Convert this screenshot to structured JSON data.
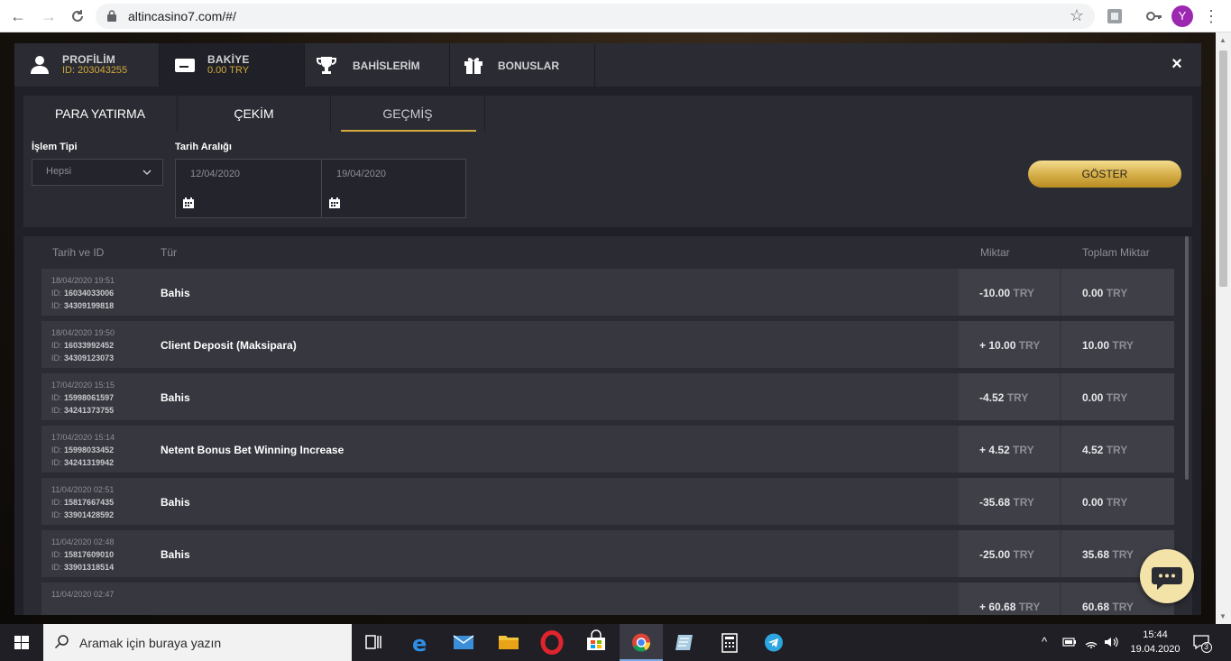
{
  "browser": {
    "url": "altincasino7.com/#/",
    "avatar_letter": "Y"
  },
  "topnav": {
    "profile": {
      "label": "PROFİLİM",
      "id_text": "ID: 203043255"
    },
    "balance": {
      "label": "BAKİYE",
      "amount": "0.00 TRY"
    },
    "bets": {
      "label": "BAHİSLERİM"
    },
    "bonuses": {
      "label": "BONUSLAR"
    },
    "close": "×"
  },
  "subtabs": [
    {
      "label": "PARA YATIRMA"
    },
    {
      "label": "ÇEKİM"
    },
    {
      "label": "GEÇMİŞ"
    }
  ],
  "filters": {
    "type_label": "İşlem Tipi",
    "type_value": "Hepsi",
    "date_label": "Tarih Aralığı",
    "date_from": "12/04/2020",
    "date_to": "19/04/2020",
    "show_button": "GÖSTER"
  },
  "table": {
    "headers": {
      "date_id": "Tarih ve ID",
      "type": "Tür",
      "amount": "Miktar",
      "total": "Toplam Miktar"
    },
    "id_prefix": "ID:",
    "currency": "TRY",
    "rows": [
      {
        "datetime": "18/04/2020 19:51",
        "id1": "16034033006",
        "id2": "34309199818",
        "type": "Bahis",
        "amount": "-10.00",
        "total": "0.00"
      },
      {
        "datetime": "18/04/2020 19:50",
        "id1": "16033992452",
        "id2": "34309123073",
        "type": "Client Deposit (Maksipara)",
        "amount": "+ 10.00",
        "total": "10.00"
      },
      {
        "datetime": "17/04/2020 15:15",
        "id1": "15998061597",
        "id2": "34241373755",
        "type": "Bahis",
        "amount": "-4.52",
        "total": "0.00"
      },
      {
        "datetime": "17/04/2020 15:14",
        "id1": "15998033452",
        "id2": "34241319942",
        "type": "Netent Bonus Bet Winning Increase",
        "amount": "+ 4.52",
        "total": "4.52"
      },
      {
        "datetime": "11/04/2020 02:51",
        "id1": "15817667435",
        "id2": "33901428592",
        "type": "Bahis",
        "amount": "-35.68",
        "total": "0.00"
      },
      {
        "datetime": "11/04/2020 02:48",
        "id1": "15817609010",
        "id2": "33901318514",
        "type": "Bahis",
        "amount": "-25.00",
        "total": "35.68"
      },
      {
        "datetime": "11/04/2020 02:47",
        "id1": "",
        "id2": "",
        "type": "",
        "amount": "+ 60.68",
        "total": "60.68"
      }
    ]
  },
  "taskbar": {
    "search_placeholder": "Aramak için buraya yazın",
    "time": "15:44",
    "date": "19.04.2020",
    "notification_count": "3"
  }
}
